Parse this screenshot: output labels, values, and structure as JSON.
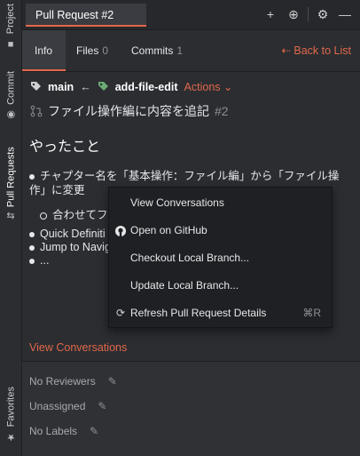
{
  "side_tabs": [
    {
      "label": "Project",
      "icon": "folder-icon",
      "icon_glyph": "■"
    },
    {
      "label": "Commit",
      "icon": "commit-icon",
      "icon_glyph": "◉"
    },
    {
      "label": "Pull Requests",
      "icon": "pull-request-icon",
      "icon_glyph": "⇵"
    },
    {
      "label": "Favorites",
      "icon": "star-icon",
      "icon_glyph": "★"
    }
  ],
  "title_tab": "Pull Request #2",
  "toolbar_icons": {
    "add": "+",
    "target": "⊕",
    "settings": "⚙",
    "minimize": "—"
  },
  "subtabs": [
    {
      "label": "Info",
      "count": ""
    },
    {
      "label": "Files",
      "count": "0"
    },
    {
      "label": "Commits",
      "count": "1"
    }
  ],
  "back_link": "⇠ Back to List",
  "branch": {
    "base": "main",
    "arrow": "←",
    "head": "add-file-edit",
    "actions": "Actions ⌄"
  },
  "pr": {
    "title": "ファイル操作編に内容を追記",
    "number": "#2"
  },
  "body": {
    "heading": "やったこと",
    "item1": "チャプター名を「基本操作：ファイル編」から「ファイル操作」に変更",
    "sub1": "合わせてフ",
    "item2": "Quick Definiti",
    "item3": "Jump to Navig",
    "item4": "..."
  },
  "view_conversations": "View Conversations",
  "meta": {
    "reviewers": "No Reviewers",
    "assignee": "Unassigned",
    "labels": "No Labels"
  },
  "menu": [
    {
      "label": "View Conversations",
      "icon": "",
      "shortcut": ""
    },
    {
      "label": "Open on GitHub",
      "icon": "github-icon",
      "shortcut": ""
    },
    {
      "label": "Checkout Local Branch...",
      "icon": "",
      "shortcut": ""
    },
    {
      "label": "Update Local Branch...",
      "icon": "",
      "shortcut": ""
    },
    {
      "label": "Refresh Pull Request Details",
      "icon": "refresh-icon",
      "shortcut": "⌘R"
    }
  ],
  "colors": {
    "accent": "#e1684a",
    "background": "#2b2d31",
    "menu_bg": "#1f2023",
    "branch_icon": "#6aab73"
  }
}
